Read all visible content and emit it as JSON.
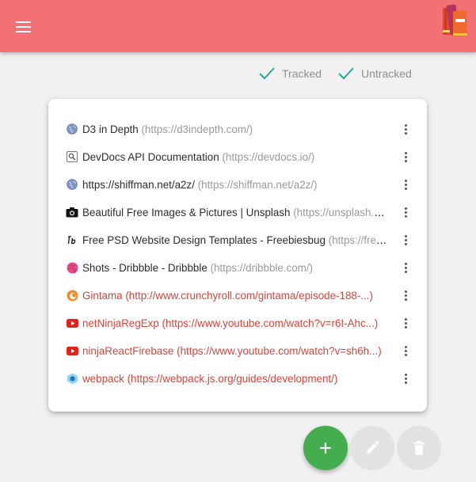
{
  "appbar": {
    "menu_icon": "hamburger-menu-icon",
    "logo_icon": "books-logo-icon",
    "color": "#f17174"
  },
  "filters": [
    {
      "label": "Tracked",
      "icon": "check-icon",
      "checked": true
    },
    {
      "label": "Untracked",
      "icon": "check-icon",
      "checked": true
    }
  ],
  "bookmarks": [
    {
      "title": "D3 in Depth",
      "url": "(https://d3indepth.com/)",
      "icon": "globe-icon",
      "status": "tracked"
    },
    {
      "title": "DevDocs API Documentation",
      "url": "(https://devdocs.io/)",
      "icon": "devdocs-icon",
      "status": "tracked"
    },
    {
      "title": "https://shiffman.net/a2z/",
      "url": "(https://shiffman.net/a2z/)",
      "icon": "globe-icon",
      "status": "tracked"
    },
    {
      "title": "Beautiful Free Images & Pictures | Unsplash",
      "url": "(https://unsplash.com/)",
      "icon": "camera-icon",
      "status": "tracked"
    },
    {
      "title": "Free PSD Website Design Templates - Freebiesbug",
      "url": "(https://freebiesbug.com/psd-freebies/)",
      "icon": "freebiesbug-icon",
      "status": "tracked"
    },
    {
      "title": "Shots - Dribbble - Dribbble",
      "url": "(https://dribbble.com/)",
      "icon": "dribbble-icon",
      "status": "tracked"
    },
    {
      "title": "Gintama",
      "url": "(http://www.crunchyroll.com/gintama/episode-188-...)",
      "icon": "crunchyroll-icon",
      "status": "untracked"
    },
    {
      "title": "netNinjaRegExp",
      "url": "(https://www.youtube.com/watch?v=r6I-Ahc...)",
      "icon": "youtube-icon",
      "status": "untracked"
    },
    {
      "title": "ninjaReactFirebase",
      "url": "(https://www.youtube.com/watch?v=sh6h...)",
      "icon": "youtube-icon",
      "status": "untracked"
    },
    {
      "title": "webpack",
      "url": "(https://webpack.js.org/guides/development/)",
      "icon": "webpack-icon",
      "status": "untracked"
    }
  ],
  "row_menu_icon": "more-vertical-icon",
  "actions": {
    "add_icon": "plus-icon",
    "edit_icon": "pencil-icon",
    "delete_icon": "trash-icon"
  },
  "colors": {
    "accent": "#f17174",
    "tracked_text": "#2c2c2c",
    "untracked_text": "#d9443a",
    "check": "#2aa79b",
    "add_button": "#44ad4e"
  }
}
